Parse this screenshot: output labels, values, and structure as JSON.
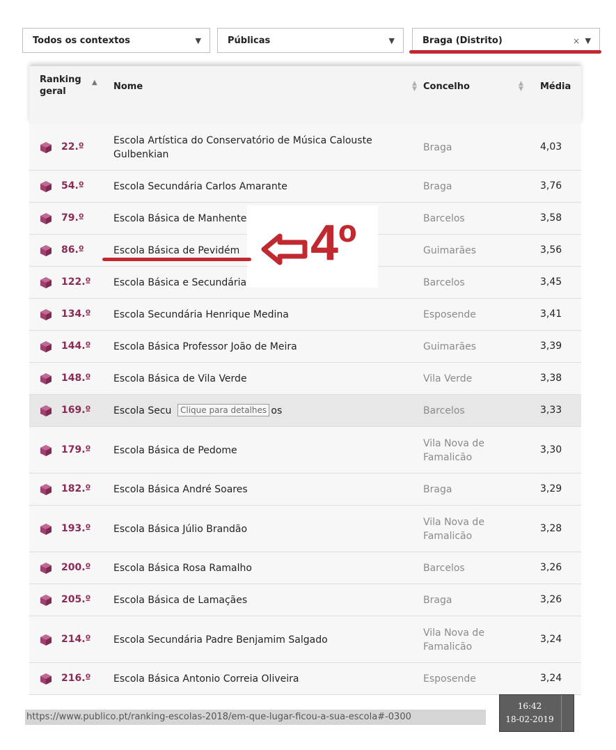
{
  "filters": {
    "context": {
      "label": "Todos os contextos",
      "arrow": "▼"
    },
    "type": {
      "label": "Públicas",
      "arrow": "▼"
    },
    "region": {
      "label": "Braga (Distrito)",
      "clear": "×",
      "arrow": "▼"
    }
  },
  "table": {
    "headers": {
      "rank": "Ranking geral",
      "rank_arrow": "▲",
      "name": "Nome",
      "concelho": "Concelho",
      "media": "Média"
    },
    "rows": [
      {
        "rank": "22.º",
        "name": "Escola Artística do Conservatório de Música Calouste Gulbenkian",
        "concelho": "Braga",
        "media": "4,03"
      },
      {
        "rank": "54.º",
        "name": "Escola Secundária Carlos Amarante",
        "concelho": "Braga",
        "media": "3,76"
      },
      {
        "rank": "79.º",
        "name": "Escola Básica de Manhente",
        "concelho": "Barcelos",
        "media": "3,58"
      },
      {
        "rank": "86.º",
        "name": "Escola Básica de Pevidém",
        "concelho": "Guimarães",
        "media": "3,56"
      },
      {
        "rank": "122.º",
        "name": "Escola Básica e Secundária de Vila Cova",
        "concelho": "Barcelos",
        "media": "3,45"
      },
      {
        "rank": "134.º",
        "name": "Escola Secundária Henrique Medina",
        "concelho": "Esposende",
        "media": "3,41"
      },
      {
        "rank": "144.º",
        "name": "Escola Básica Professor João de Meira",
        "concelho": "Guimarães",
        "media": "3,39"
      },
      {
        "rank": "148.º",
        "name": "Escola Básica de Vila Verde",
        "concelho": "Vila Verde",
        "media": "3,38"
      },
      {
        "rank": "169.º",
        "name": "Escola Secu",
        "name_tail": "os",
        "tooltip": "Clique para detalhes",
        "concelho": "Barcelos",
        "media": "3,33"
      },
      {
        "rank": "179.º",
        "name": "Escola Básica de Pedome",
        "concelho": "Vila Nova de Famalicão",
        "media": "3,30"
      },
      {
        "rank": "182.º",
        "name": "Escola Básica André Soares",
        "concelho": "Braga",
        "media": "3,29"
      },
      {
        "rank": "193.º",
        "name": "Escola Básica Júlio Brandão",
        "concelho": "Vila Nova de Famalicão",
        "media": "3,28"
      },
      {
        "rank": "200.º",
        "name": "Escola Básica Rosa Ramalho",
        "concelho": "Barcelos",
        "media": "3,26"
      },
      {
        "rank": "205.º",
        "name": "Escola Básica de Lamaçães",
        "concelho": "Braga",
        "media": "3,26"
      },
      {
        "rank": "214.º",
        "name": "Escola Secundária Padre Benjamim Salgado",
        "concelho": "Vila Nova de Famalicão",
        "media": "3,24"
      },
      {
        "rank": "216.º",
        "name": "Escola Básica Antonio Correia Oliveira",
        "concelho": "Esposende",
        "media": "3,24"
      }
    ]
  },
  "annotation": {
    "text": "4º",
    "color": "#c0292f"
  },
  "status": {
    "url": "https://www.publico.pt/ranking-escolas-2018/em-que-lugar-ficou-a-sua-escola#-0300"
  },
  "clock": {
    "time": "16:42",
    "date": "18-02-2019"
  },
  "colors": {
    "rank": "#8a2a55",
    "cube": "#a0406e",
    "accent_red": "#c0292f"
  }
}
